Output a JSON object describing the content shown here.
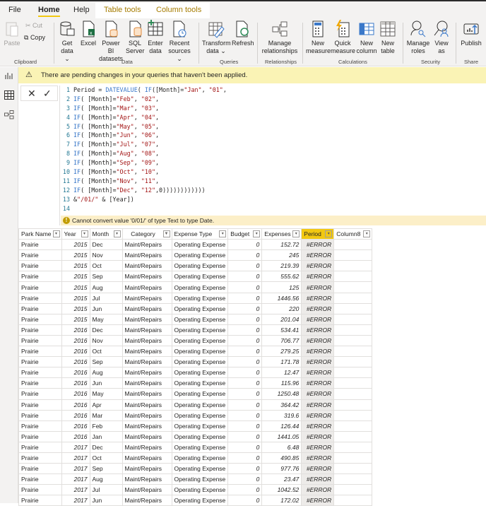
{
  "tabs": [
    {
      "label": "File"
    },
    {
      "label": "Home"
    },
    {
      "label": "Help"
    },
    {
      "label": "Table tools"
    },
    {
      "label": "Column tools"
    }
  ],
  "ribbon": {
    "clipboard": {
      "paste": "Paste",
      "cut": "Cut",
      "copy": "Copy",
      "group": "Clipboard"
    },
    "data": {
      "get_data": [
        "Get",
        "data ⌄"
      ],
      "excel": [
        "Excel",
        ""
      ],
      "powerbi": [
        "Power BI",
        "datasets"
      ],
      "sql": [
        "SQL",
        "Server"
      ],
      "enter": [
        "Enter",
        "data"
      ],
      "recent": [
        "Recent",
        "sources ⌄"
      ],
      "group": "Data"
    },
    "queries": {
      "transform": [
        "Transform",
        "data ⌄"
      ],
      "refresh": [
        "Refresh",
        ""
      ],
      "group": "Queries"
    },
    "relationships": {
      "manage": [
        "Manage",
        "relationships"
      ],
      "group": "Relationships"
    },
    "calculations": {
      "new_measure": [
        "New",
        "measure"
      ],
      "quick_measure": [
        "Quick",
        "measure"
      ],
      "new_column": [
        "New",
        "column"
      ],
      "new_table": [
        "New",
        "table"
      ],
      "group": "Calculations"
    },
    "security": {
      "manage_roles": [
        "Manage",
        "roles"
      ],
      "view_as": [
        "View",
        "as"
      ],
      "group": "Security"
    },
    "share": {
      "publish": [
        "Publish",
        ""
      ],
      "group": "Share"
    }
  },
  "banner": {
    "text": "There are pending changes in your queries that haven't been applied."
  },
  "formula": {
    "lines": [
      [
        [
          "Period = ",
          "tx"
        ],
        [
          "DATEVALUE",
          "kw"
        ],
        [
          "( ",
          "tx"
        ],
        [
          "IF",
          "kw"
        ],
        [
          "([Month]=",
          "tx"
        ],
        [
          "\"Jan\"",
          "st"
        ],
        [
          ", ",
          "tx"
        ],
        [
          "\"01\"",
          "st"
        ],
        [
          ",",
          "tx"
        ]
      ],
      [
        [
          "IF",
          "kw"
        ],
        [
          "( [Month]=",
          "tx"
        ],
        [
          "\"Feb\"",
          "st"
        ],
        [
          ", ",
          "tx"
        ],
        [
          "\"02\"",
          "st"
        ],
        [
          ",",
          "tx"
        ]
      ],
      [
        [
          "IF",
          "kw"
        ],
        [
          "( [Month]=",
          "tx"
        ],
        [
          "\"Mar\"",
          "st"
        ],
        [
          ", ",
          "tx"
        ],
        [
          "\"03\"",
          "st"
        ],
        [
          ",",
          "tx"
        ]
      ],
      [
        [
          "IF",
          "kw"
        ],
        [
          "( [Month]=",
          "tx"
        ],
        [
          "\"Apr\"",
          "st"
        ],
        [
          ", ",
          "tx"
        ],
        [
          "\"04\"",
          "st"
        ],
        [
          ",",
          "tx"
        ]
      ],
      [
        [
          "IF",
          "kw"
        ],
        [
          "( [Month]=",
          "tx"
        ],
        [
          "\"May\"",
          "st"
        ],
        [
          ", ",
          "tx"
        ],
        [
          "\"05\"",
          "st"
        ],
        [
          ",",
          "tx"
        ]
      ],
      [
        [
          "IF",
          "kw"
        ],
        [
          "( [Month]=",
          "tx"
        ],
        [
          "\"Jun\"",
          "st"
        ],
        [
          ", ",
          "tx"
        ],
        [
          "\"06\"",
          "st"
        ],
        [
          ",",
          "tx"
        ]
      ],
      [
        [
          "IF",
          "kw"
        ],
        [
          "( [Month]=",
          "tx"
        ],
        [
          "\"Jul\"",
          "st"
        ],
        [
          ", ",
          "tx"
        ],
        [
          "\"07\"",
          "st"
        ],
        [
          ",",
          "tx"
        ]
      ],
      [
        [
          "IF",
          "kw"
        ],
        [
          "( [Month]=",
          "tx"
        ],
        [
          "\"Aug\"",
          "st"
        ],
        [
          ", ",
          "tx"
        ],
        [
          "\"08\"",
          "st"
        ],
        [
          ",",
          "tx"
        ]
      ],
      [
        [
          "IF",
          "kw"
        ],
        [
          "( [Month]=",
          "tx"
        ],
        [
          "\"Sep\"",
          "st"
        ],
        [
          ", ",
          "tx"
        ],
        [
          "\"09\"",
          "st"
        ],
        [
          ",",
          "tx"
        ]
      ],
      [
        [
          "IF",
          "kw"
        ],
        [
          "( [Month]=",
          "tx"
        ],
        [
          "\"Oct\"",
          "st"
        ],
        [
          ", ",
          "tx"
        ],
        [
          "\"10\"",
          "st"
        ],
        [
          ",",
          "tx"
        ]
      ],
      [
        [
          "IF",
          "kw"
        ],
        [
          "( [Month]=",
          "tx"
        ],
        [
          "\"Nov\"",
          "st"
        ],
        [
          ", ",
          "tx"
        ],
        [
          "\"11\"",
          "st"
        ],
        [
          ",",
          "tx"
        ]
      ],
      [
        [
          "IF",
          "kw"
        ],
        [
          "( [Month]=",
          "tx"
        ],
        [
          "\"Dec\"",
          "st"
        ],
        [
          ", ",
          "tx"
        ],
        [
          "\"12\"",
          "st"
        ],
        [
          ",0))))))))))))",
          "tx"
        ]
      ],
      [
        [
          "&",
          "tx"
        ],
        [
          "\"/01/\"",
          "st"
        ],
        [
          " & [Year])",
          "tx"
        ]
      ],
      []
    ],
    "error": "Cannot convert value '0/01/' of type Text to type Date."
  },
  "table": {
    "columns": [
      "Park Name",
      "Year",
      "Month",
      "Category",
      "Expense Type",
      "Budget",
      "Expenses",
      "Period",
      "Column8"
    ],
    "selected_column": "Period",
    "rows": [
      [
        "Prairie",
        "2015",
        "Dec",
        "Maint/Repairs",
        "Operating Expense",
        "0",
        "152.72",
        "#ERROR",
        ""
      ],
      [
        "Prairie",
        "2015",
        "Nov",
        "Maint/Repairs",
        "Operating Expense",
        "0",
        "245",
        "#ERROR",
        ""
      ],
      [
        "Prairie",
        "2015",
        "Oct",
        "Maint/Repairs",
        "Operating Expense",
        "0",
        "219.39",
        "#ERROR",
        ""
      ],
      [
        "Prairie",
        "2015",
        "Sep",
        "Maint/Repairs",
        "Operating Expense",
        "0",
        "555.62",
        "#ERROR",
        ""
      ],
      [
        "Prairie",
        "2015",
        "Aug",
        "Maint/Repairs",
        "Operating Expense",
        "0",
        "125",
        "#ERROR",
        ""
      ],
      [
        "Prairie",
        "2015",
        "Jul",
        "Maint/Repairs",
        "Operating Expense",
        "0",
        "1446.56",
        "#ERROR",
        ""
      ],
      [
        "Prairie",
        "2015",
        "Jun",
        "Maint/Repairs",
        "Operating Expense",
        "0",
        "220",
        "#ERROR",
        ""
      ],
      [
        "Prairie",
        "2015",
        "May",
        "Maint/Repairs",
        "Operating Expense",
        "0",
        "201.04",
        "#ERROR",
        ""
      ],
      [
        "Prairie",
        "2016",
        "Dec",
        "Maint/Repairs",
        "Operating Expense",
        "0",
        "534.41",
        "#ERROR",
        ""
      ],
      [
        "Prairie",
        "2016",
        "Nov",
        "Maint/Repairs",
        "Operating Expense",
        "0",
        "706.77",
        "#ERROR",
        ""
      ],
      [
        "Prairie",
        "2016",
        "Oct",
        "Maint/Repairs",
        "Operating Expense",
        "0",
        "279.25",
        "#ERROR",
        ""
      ],
      [
        "Prairie",
        "2016",
        "Sep",
        "Maint/Repairs",
        "Operating Expense",
        "0",
        "171.78",
        "#ERROR",
        ""
      ],
      [
        "Prairie",
        "2016",
        "Aug",
        "Maint/Repairs",
        "Operating Expense",
        "0",
        "12.47",
        "#ERROR",
        ""
      ],
      [
        "Prairie",
        "2016",
        "Jun",
        "Maint/Repairs",
        "Operating Expense",
        "0",
        "115.96",
        "#ERROR",
        ""
      ],
      [
        "Prairie",
        "2016",
        "May",
        "Maint/Repairs",
        "Operating Expense",
        "0",
        "1250.48",
        "#ERROR",
        ""
      ],
      [
        "Prairie",
        "2016",
        "Apr",
        "Maint/Repairs",
        "Operating Expense",
        "0",
        "364.42",
        "#ERROR",
        ""
      ],
      [
        "Prairie",
        "2016",
        "Mar",
        "Maint/Repairs",
        "Operating Expense",
        "0",
        "319.6",
        "#ERROR",
        ""
      ],
      [
        "Prairie",
        "2016",
        "Feb",
        "Maint/Repairs",
        "Operating Expense",
        "0",
        "126.44",
        "#ERROR",
        ""
      ],
      [
        "Prairie",
        "2016",
        "Jan",
        "Maint/Repairs",
        "Operating Expense",
        "0",
        "1441.05",
        "#ERROR",
        ""
      ],
      [
        "Prairie",
        "2017",
        "Dec",
        "Maint/Repairs",
        "Operating Expense",
        "0",
        "6.48",
        "#ERROR",
        ""
      ],
      [
        "Prairie",
        "2017",
        "Oct",
        "Maint/Repairs",
        "Operating Expense",
        "0",
        "490.85",
        "#ERROR",
        ""
      ],
      [
        "Prairie",
        "2017",
        "Sep",
        "Maint/Repairs",
        "Operating Expense",
        "0",
        "977.76",
        "#ERROR",
        ""
      ],
      [
        "Prairie",
        "2017",
        "Aug",
        "Maint/Repairs",
        "Operating Expense",
        "0",
        "23.47",
        "#ERROR",
        ""
      ],
      [
        "Prairie",
        "2017",
        "Jul",
        "Maint/Repairs",
        "Operating Expense",
        "0",
        "1042.52",
        "#ERROR",
        ""
      ],
      [
        "Prairie",
        "2017",
        "Jun",
        "Maint/Repairs",
        "Operating Expense",
        "0",
        "172.02",
        "#ERROR",
        ""
      ]
    ]
  },
  "colors": {
    "accent": "#f2c811",
    "banner": "#faf3b5",
    "context_tab": "#a67c00"
  }
}
